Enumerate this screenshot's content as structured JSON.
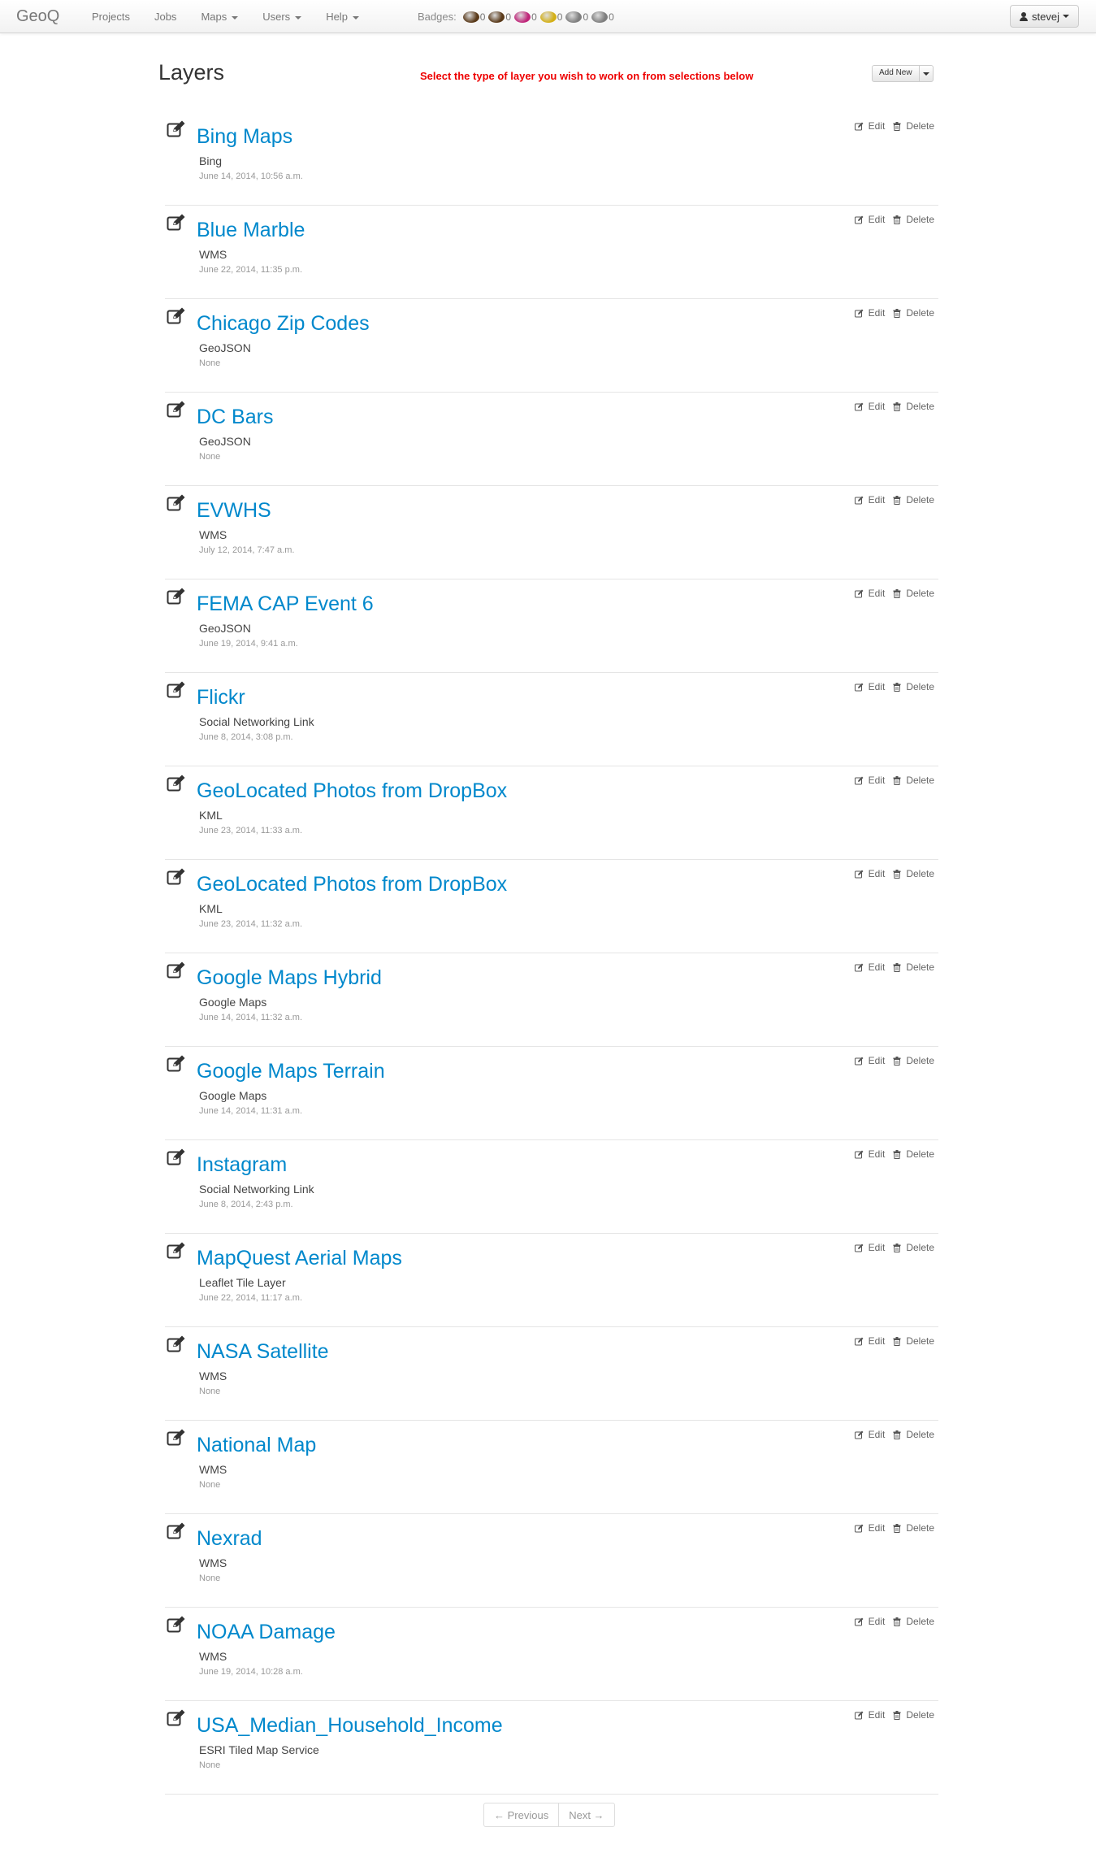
{
  "navbar": {
    "brand": "GeoQ",
    "items": [
      {
        "label": "Projects",
        "dropdown": false
      },
      {
        "label": "Jobs",
        "dropdown": false
      },
      {
        "label": "Maps",
        "dropdown": true
      },
      {
        "label": "Users",
        "dropdown": true
      },
      {
        "label": "Help",
        "dropdown": true
      }
    ],
    "badges_label": "Badges:",
    "badges": [
      {
        "icon": "brown-badge-icon",
        "color": "#5a3a1a",
        "count": "0"
      },
      {
        "icon": "brown-badge-icon",
        "color": "#5a3a1a",
        "count": "0"
      },
      {
        "icon": "pink-badge-icon",
        "color": "#c0267a",
        "count": "0"
      },
      {
        "icon": "gold-badge-icon",
        "color": "#d4b017",
        "count": "0"
      },
      {
        "icon": "gray-badge-icon",
        "color": "#7f7f7f",
        "count": "0"
      },
      {
        "icon": "gray-badge-icon",
        "color": "#7f7f7f",
        "count": "0"
      }
    ],
    "user": "stevej"
  },
  "header": {
    "title": "Layers",
    "instruction": "Select the type of layer you wish to work on from selections below",
    "add_new": "Add New"
  },
  "actions": {
    "edit": "Edit",
    "delete": "Delete"
  },
  "layers": [
    {
      "name": "Bing Maps",
      "type": "Bing",
      "date": "June 14, 2014, 10:56 a.m."
    },
    {
      "name": "Blue Marble",
      "type": "WMS",
      "date": "June 22, 2014, 11:35 p.m."
    },
    {
      "name": "Chicago Zip Codes",
      "type": "GeoJSON",
      "date": "None"
    },
    {
      "name": "DC Bars",
      "type": "GeoJSON",
      "date": "None"
    },
    {
      "name": "EVWHS",
      "type": "WMS",
      "date": "July 12, 2014, 7:47 a.m."
    },
    {
      "name": "FEMA CAP Event 6",
      "type": "GeoJSON",
      "date": "June 19, 2014, 9:41 a.m."
    },
    {
      "name": "Flickr",
      "type": "Social Networking Link",
      "date": "June 8, 2014, 3:08 p.m."
    },
    {
      "name": "GeoLocated Photos from DropBox",
      "type": "KML",
      "date": "June 23, 2014, 11:33 a.m."
    },
    {
      "name": "GeoLocated Photos from DropBox",
      "type": "KML",
      "date": "June 23, 2014, 11:32 a.m."
    },
    {
      "name": "Google Maps Hybrid",
      "type": "Google Maps",
      "date": "June 14, 2014, 11:32 a.m."
    },
    {
      "name": "Google Maps Terrain",
      "type": "Google Maps",
      "date": "June 14, 2014, 11:31 a.m."
    },
    {
      "name": "Instagram",
      "type": "Social Networking Link",
      "date": "June 8, 2014, 2:43 p.m."
    },
    {
      "name": "MapQuest Aerial Maps",
      "type": "Leaflet Tile Layer",
      "date": "June 22, 2014, 11:17 a.m."
    },
    {
      "name": "NASA Satellite",
      "type": "WMS",
      "date": "None"
    },
    {
      "name": "National Map",
      "type": "WMS",
      "date": "None"
    },
    {
      "name": "Nexrad",
      "type": "WMS",
      "date": "None"
    },
    {
      "name": "NOAA Damage",
      "type": "WMS",
      "date": "June 19, 2014, 10:28 a.m."
    },
    {
      "name": "USA_Median_Household_Income",
      "type": "ESRI Tiled Map Service",
      "date": "None"
    }
  ],
  "pager": {
    "previous": "← Previous",
    "next": "Next →"
  }
}
